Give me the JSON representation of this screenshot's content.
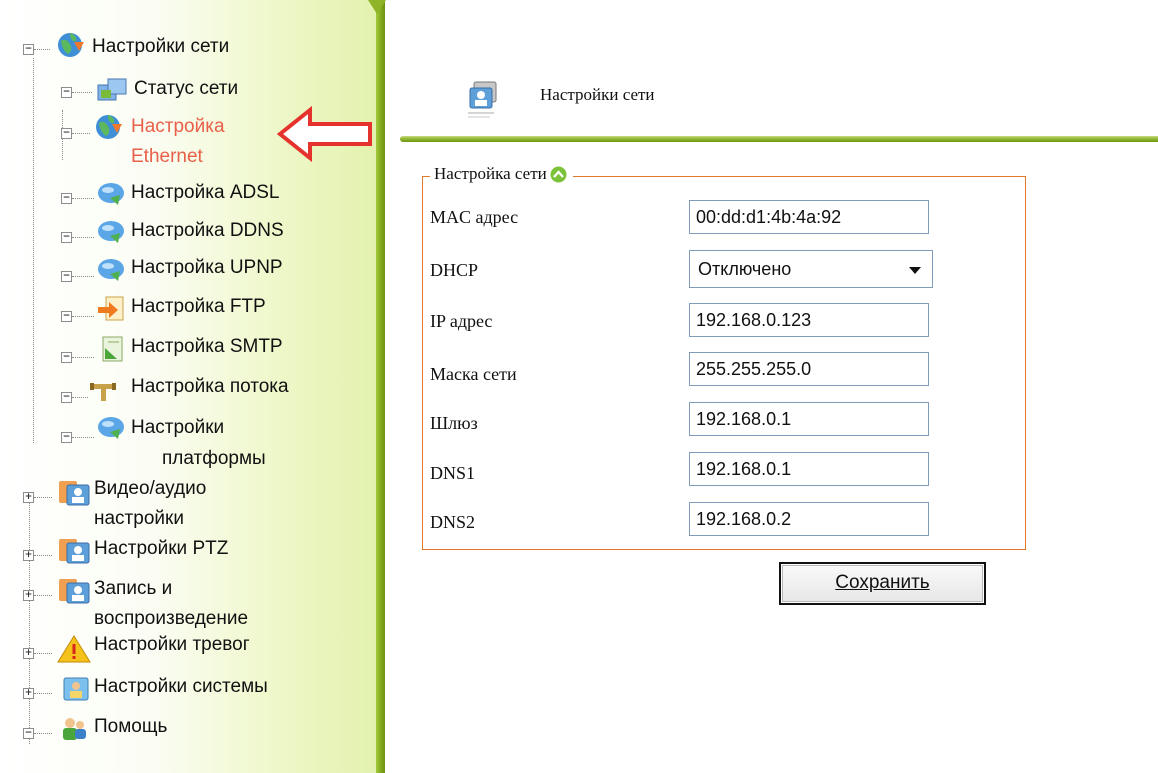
{
  "sidebar": {
    "items": [
      {
        "label": "Настройки сети",
        "icon": "globe-icon",
        "expander": "−"
      },
      {
        "label": "Статус сети",
        "icon": "network-status-icon",
        "expander": "−"
      },
      {
        "label": "Настройка",
        "label2": "Ethernet",
        "icon": "globe-icon",
        "expander": "−",
        "active": true
      },
      {
        "label": "Настройка ADSL",
        "icon": "speech-bubble-icon",
        "expander": "−"
      },
      {
        "label": "Настройка DDNS",
        "icon": "speech-bubble-icon",
        "expander": "−"
      },
      {
        "label": "Настройка UPNP",
        "icon": "speech-bubble-icon",
        "expander": "−"
      },
      {
        "label": "Настройка FTP",
        "icon": "ftp-icon",
        "expander": "−"
      },
      {
        "label": "Настройка SMTP",
        "icon": "smtp-icon",
        "expander": "−"
      },
      {
        "label": "Настройка потока",
        "icon": "pipe-icon",
        "expander": "−"
      },
      {
        "label": "Настройки",
        "label2": "платформы",
        "icon": "speech-bubble-icon",
        "expander": "−"
      },
      {
        "label": "Видео/аудио",
        "label2": "настройки",
        "icon": "user-card-icon",
        "expander": "+"
      },
      {
        "label": "Настройки PTZ",
        "icon": "user-card-icon",
        "expander": "+"
      },
      {
        "label": "Запись и",
        "label2": "воспроизведение",
        "icon": "user-card-icon",
        "expander": "+"
      },
      {
        "label": "Настройки тревог",
        "icon": "warning-icon",
        "expander": "+"
      },
      {
        "label": "Настройки системы",
        "icon": "system-user-icon",
        "expander": "+"
      },
      {
        "label": "Помощь",
        "icon": "help-people-icon",
        "expander": "−"
      }
    ]
  },
  "header": {
    "title": "Настройки сети",
    "icon": "network-settings-icon"
  },
  "form": {
    "legend": "Настройка сети",
    "fields": [
      {
        "label": "MAC адрес",
        "value": "00:dd:d1:4b:4a:92"
      },
      {
        "label": "DHCP",
        "value": "Отключено"
      },
      {
        "label": "IP адрес",
        "value": "192.168.0.123"
      },
      {
        "label": "Маска сети",
        "value": "255.255.255.0"
      },
      {
        "label": "Шлюз",
        "value": "192.168.0.1"
      },
      {
        "label": "DNS1",
        "value": "192.168.0.1"
      },
      {
        "label": "DNS2",
        "value": "192.168.0.2"
      }
    ],
    "save_label": "Сохранить"
  },
  "colors": {
    "accent_green": "#8fb42e",
    "fieldset_border": "#e27a2a",
    "active_item": "#e8604a",
    "annotation_arrow": "#e5322d"
  }
}
